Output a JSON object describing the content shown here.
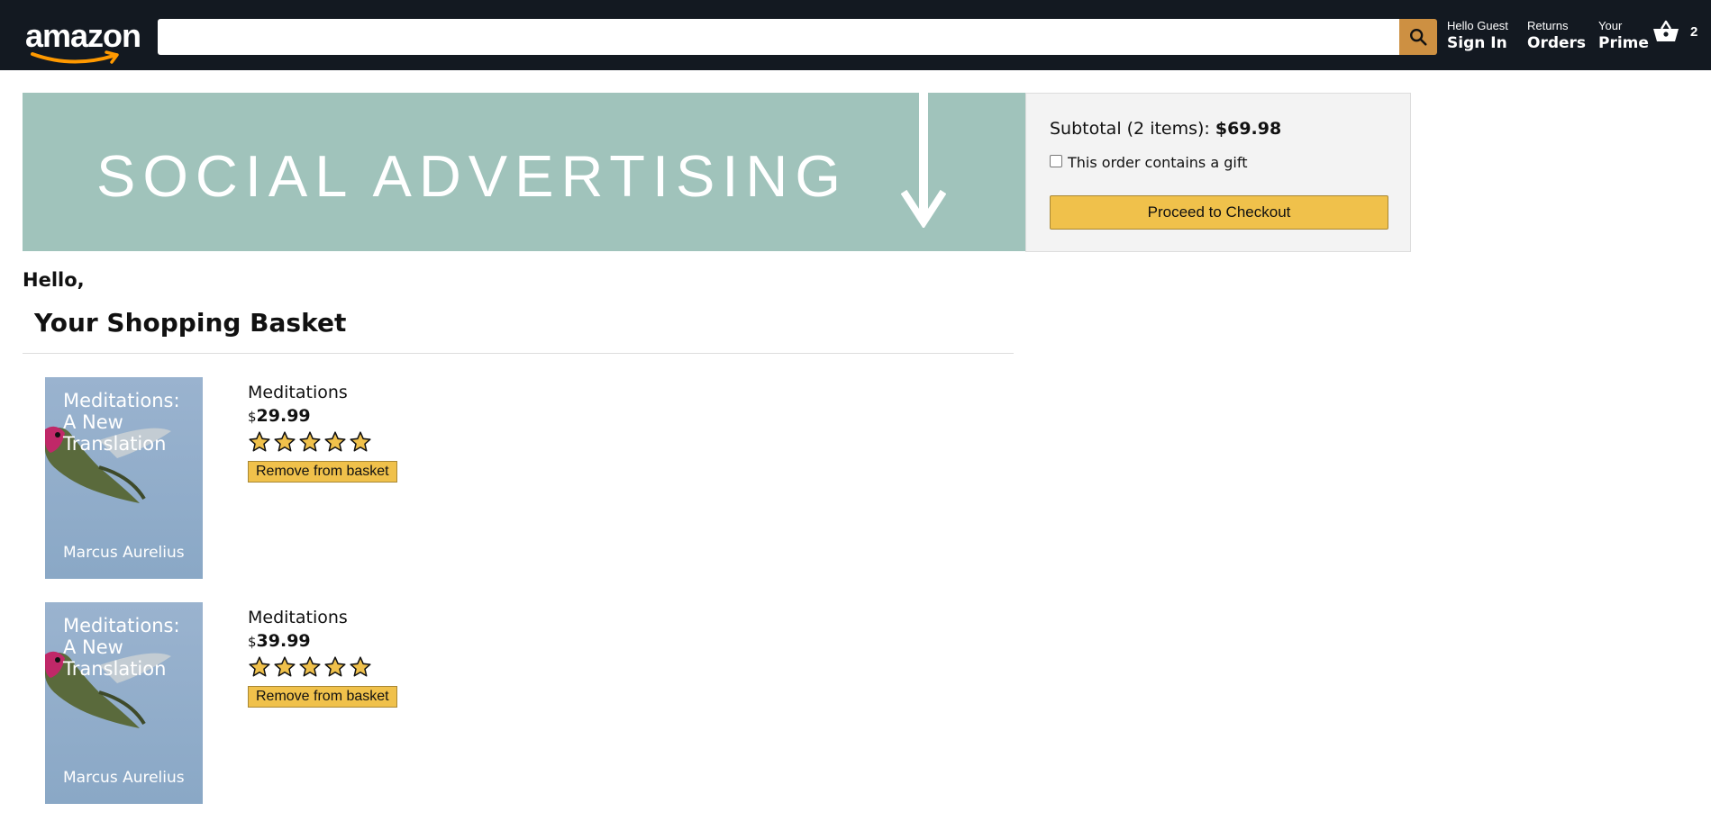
{
  "header": {
    "logo": "amazon",
    "search": {
      "value": "",
      "placeholder": ""
    },
    "nav": {
      "account": {
        "line1": "Hello Guest",
        "line2": "Sign In"
      },
      "orders": {
        "line1": "Returns",
        "line2": "Orders"
      },
      "prime": {
        "line1": "Your",
        "line2": "Prime"
      }
    },
    "basket_count": "2"
  },
  "banner": {
    "text": "SOCIAL ADVERTISING"
  },
  "subtotal": {
    "label": "Subtotal (2 items):",
    "amount": "$69.98",
    "gift_label": "This order contains a gift",
    "checkout_label": "Proceed to Checkout"
  },
  "greeting": "Hello,",
  "basket_title": "Your Shopping Basket",
  "items": [
    {
      "cover_title": "Meditations: A New Translation",
      "cover_author": "Marcus Aurelius",
      "title": "Meditations",
      "currency": "$",
      "price": "29.99",
      "rating": 5,
      "remove_label": "Remove from basket"
    },
    {
      "cover_title": "Meditations: A New Translation",
      "cover_author": "Marcus Aurelius",
      "title": "Meditations",
      "currency": "$",
      "price": "39.99",
      "rating": 5,
      "remove_label": "Remove from basket"
    }
  ],
  "colors": {
    "header_bg": "#131921",
    "search_button": "#cd9042",
    "button_yellow": "#f0c14b",
    "banner_bg": "#a0c3bb",
    "subtotal_bg": "#f3f3f3",
    "star": "#f0c14b"
  },
  "icons": {
    "search": "search-icon",
    "basket": "basket-icon",
    "star": "star-icon",
    "logo_smile": "smile-arrow-icon"
  }
}
